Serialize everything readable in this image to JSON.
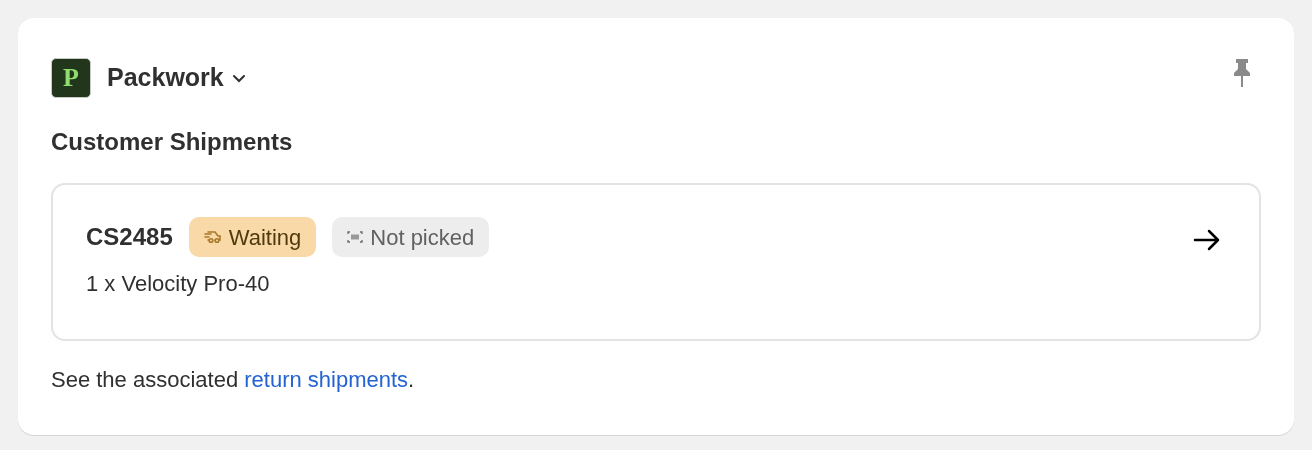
{
  "app": {
    "logo_letter": "P",
    "name": "Packwork"
  },
  "section_title": "Customer Shipments",
  "shipment": {
    "id": "CS2485",
    "badges": [
      {
        "kind": "delivery",
        "label": "Waiting"
      },
      {
        "kind": "picking",
        "label": "Not picked"
      }
    ],
    "items": "1 x Velocity Pro-40"
  },
  "footer": {
    "text": "See the associated ",
    "link": "return shipments",
    "end": "."
  }
}
